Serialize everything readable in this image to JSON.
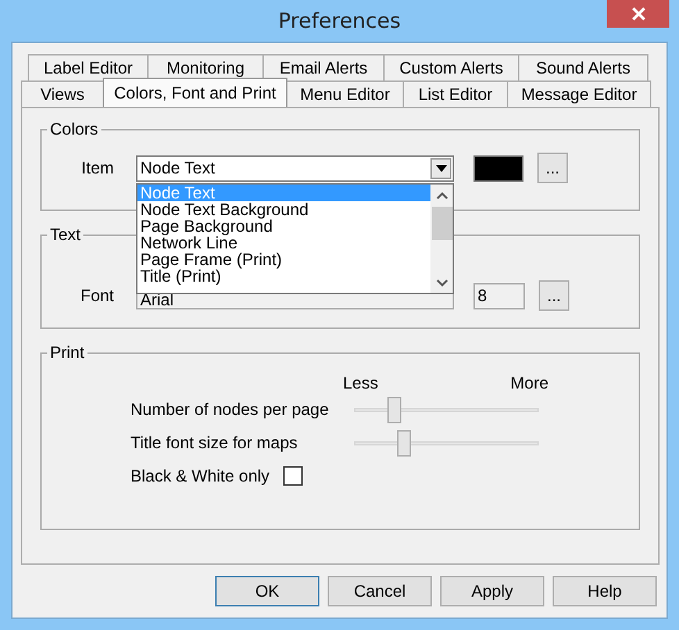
{
  "window": {
    "title": "Preferences"
  },
  "tab_rows": [
    [
      {
        "label": "Label Editor",
        "selected": false
      },
      {
        "label": "Monitoring",
        "selected": false
      },
      {
        "label": "Email Alerts",
        "selected": false
      },
      {
        "label": "Custom Alerts",
        "selected": false
      },
      {
        "label": "Sound Alerts",
        "selected": false
      }
    ],
    [
      {
        "label": "Views",
        "selected": false
      },
      {
        "label": "Colors, Font and Print",
        "selected": true
      },
      {
        "label": "Menu Editor",
        "selected": false
      },
      {
        "label": "List Editor",
        "selected": false
      },
      {
        "label": "Message Editor",
        "selected": false
      }
    ]
  ],
  "colors": {
    "title": "Colors",
    "item_label": "Item",
    "item_value": "Node Text",
    "expanded": true,
    "options": [
      {
        "label": "Node Text",
        "selected": true
      },
      {
        "label": "Node Text Background",
        "selected": false
      },
      {
        "label": "Page Background",
        "selected": false
      },
      {
        "label": "Network Line",
        "selected": false
      },
      {
        "label": "Page Frame (Print)",
        "selected": false
      },
      {
        "label": "Title (Print)",
        "selected": false
      }
    ],
    "swatch": {
      "color": "#000000"
    },
    "browse": "..."
  },
  "text": {
    "title": "Text",
    "font_label": "Font",
    "font_value": "Arial",
    "size_value": "8",
    "browse": "..."
  },
  "print": {
    "title": "Print",
    "less": "Less",
    "more": "More",
    "sliders": [
      {
        "label": "Number of nodes per page",
        "level": 0.2
      },
      {
        "label": "Title font size for maps",
        "level": 0.25
      }
    ],
    "bw_label": "Black & White only",
    "bw_checked": false
  },
  "buttons": [
    "OK",
    "Cancel",
    "Apply",
    "Help"
  ]
}
